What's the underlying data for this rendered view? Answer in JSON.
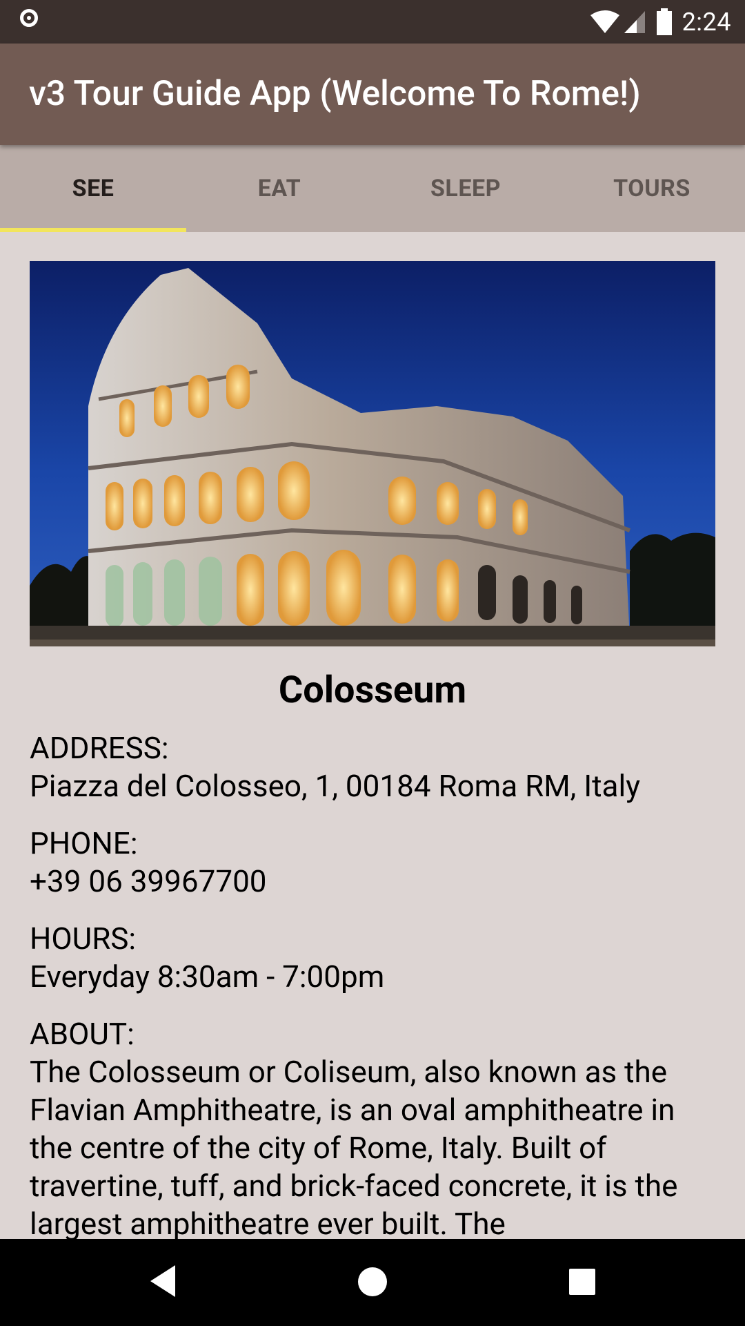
{
  "status_bar": {
    "time": "2:24",
    "left_icon": "record-icon",
    "icons": [
      "wifi-icon",
      "signal-icon",
      "battery-icon"
    ]
  },
  "app_bar": {
    "title": "v3 Tour Guide App (Welcome To Rome!)"
  },
  "tabs": [
    {
      "label": "SEE",
      "active": true
    },
    {
      "label": "EAT",
      "active": false
    },
    {
      "label": "SLEEP",
      "active": false
    },
    {
      "label": "TOURS",
      "active": false
    }
  ],
  "place": {
    "image_label": "Colosseum photo",
    "name": "Colosseum",
    "address_label": "ADDRESS:",
    "address": "Piazza del Colosseo, 1, 00184 Roma RM, Italy",
    "phone_label": "PHONE:",
    "phone": "+39 06 39967700",
    "hours_label": "HOURS:",
    "hours": "Everyday 8:30am - 7:00pm",
    "about_label": "ABOUT:",
    "about": "The Colosseum or Coliseum, also known as the Flavian Amphitheatre, is an oval amphitheatre in the centre of the city of Rome, Italy. Built of travertine, tuff, and brick-faced concrete, it is the largest amphitheatre ever built. The"
  },
  "nav_bar": {
    "icons": [
      "back-icon",
      "home-icon",
      "recents-icon"
    ]
  },
  "colors": {
    "status_bar": "#3b302d",
    "app_bar": "#725b53",
    "tab_bar": "#b9aca7",
    "tab_indicator": "#f2e55c",
    "background": "#ddd5d3"
  }
}
